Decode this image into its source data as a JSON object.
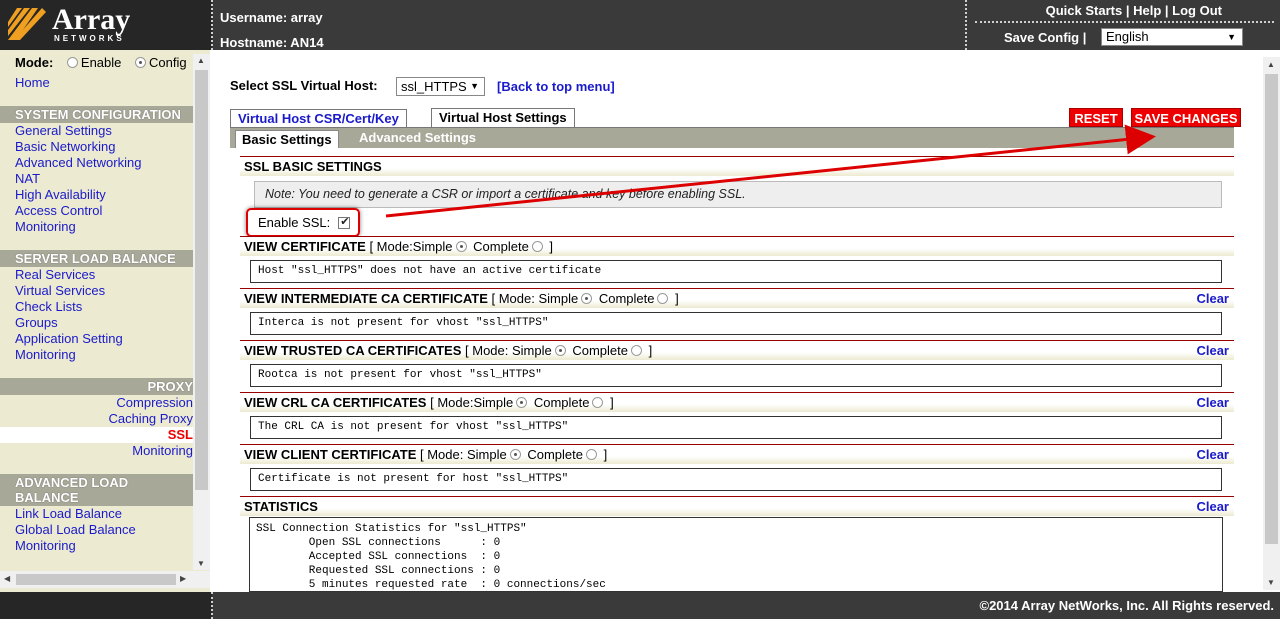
{
  "header": {
    "logo_name": "Array",
    "logo_sub": "NETWORKS",
    "username_label": "Username: array",
    "hostname_label": "Hostname: AN14",
    "quick_starts": "Quick Starts",
    "help": "Help",
    "logout": "Log Out",
    "separator": "|",
    "save_config": "Save Config",
    "language": "English"
  },
  "sidebar": {
    "mode_label": "Mode:",
    "mode_enable": "Enable",
    "mode_config": "Config",
    "home": "Home",
    "system_configuration": {
      "title": "SYSTEM CONFIGURATION",
      "items": [
        "General Settings",
        "Basic Networking",
        "Advanced Networking",
        "NAT",
        "High Availability",
        "Access Control",
        "Monitoring"
      ]
    },
    "server_load_balance": {
      "title": "SERVER LOAD BALANCE",
      "items": [
        "Real Services",
        "Virtual Services",
        "Check Lists",
        "Groups",
        "Application Setting",
        "Monitoring"
      ]
    },
    "proxy": {
      "title": "PROXY",
      "items": [
        "Compression",
        "Caching Proxy",
        "SSL",
        "Monitoring"
      ]
    },
    "advanced_load_balance": {
      "title_line1": "ADVANCED LOAD",
      "title_line2": "BALANCE",
      "items": [
        "Link Load Balance",
        "Global Load Balance",
        "Monitoring"
      ]
    }
  },
  "main": {
    "select_label": "Select SSL Virtual Host:",
    "virtual_host": "ssl_HTTPS",
    "back_link": "[Back to top menu]",
    "tabs": [
      "Virtual Host CSR/Cert/Key",
      "Virtual Host Settings"
    ],
    "reset": "RESET",
    "save_changes": "SAVE CHANGES",
    "subtabs": [
      "Basic Settings",
      "Advanced Settings"
    ],
    "ssl_basic": {
      "title": "SSL BASIC SETTINGS",
      "note": "Note: You need to generate a CSR or import a certificate and key before enabling SSL.",
      "enable_label": "Enable SSL:",
      "enable_checked": true
    },
    "sections": [
      {
        "title": "VIEW CERTIFICATE",
        "mode_open": "[ Mode:Simple",
        "complete": "Complete",
        "mode_close": "]",
        "clear": "",
        "content": "Host \"ssl_HTTPS\" does not have an active certificate"
      },
      {
        "title": "VIEW INTERMEDIATE CA CERTIFICATE",
        "mode_open": "[ Mode: Simple",
        "complete": "Complete",
        "mode_close": "]",
        "clear": "Clear",
        "content": "Interca is not present for vhost \"ssl_HTTPS\""
      },
      {
        "title": "VIEW TRUSTED CA CERTIFICATES",
        "mode_open": "[ Mode: Simple",
        "complete": "Complete",
        "mode_close": "]",
        "clear": "Clear",
        "content": "Rootca is not present for vhost \"ssl_HTTPS\""
      },
      {
        "title": "VIEW CRL CA CERTIFICATES",
        "mode_open": "[ Mode:Simple",
        "complete": "Complete",
        "mode_close": "]",
        "clear": "Clear",
        "content": "The CRL CA is not present for vhost \"ssl_HTTPS\""
      },
      {
        "title": "VIEW CLIENT CERTIFICATE",
        "mode_open": "[ Mode: Simple",
        "complete": "Complete",
        "mode_close": "]",
        "clear": "Clear",
        "content": "Certificate is not present for host \"ssl_HTTPS\""
      }
    ],
    "statistics": {
      "title": "STATISTICS",
      "clear": "Clear",
      "lines": [
        "SSL Connection Statistics for \"ssl_HTTPS\"",
        "        Open SSL connections      : 0",
        "        Accepted SSL connections  : 0",
        "        Requested SSL connections : 0",
        "        5 minutes requested rate  : 0 connections/sec"
      ]
    }
  },
  "footer": {
    "copyright": "©2014 Array NetWorks, Inc. All Rights reserved."
  },
  "colors": {
    "accent_red": "#e00000",
    "header_bg": "#3a3a3a",
    "sidebar_bg": "#ecead0",
    "section_bar": "#a8a898",
    "link": "#1a1acc"
  }
}
